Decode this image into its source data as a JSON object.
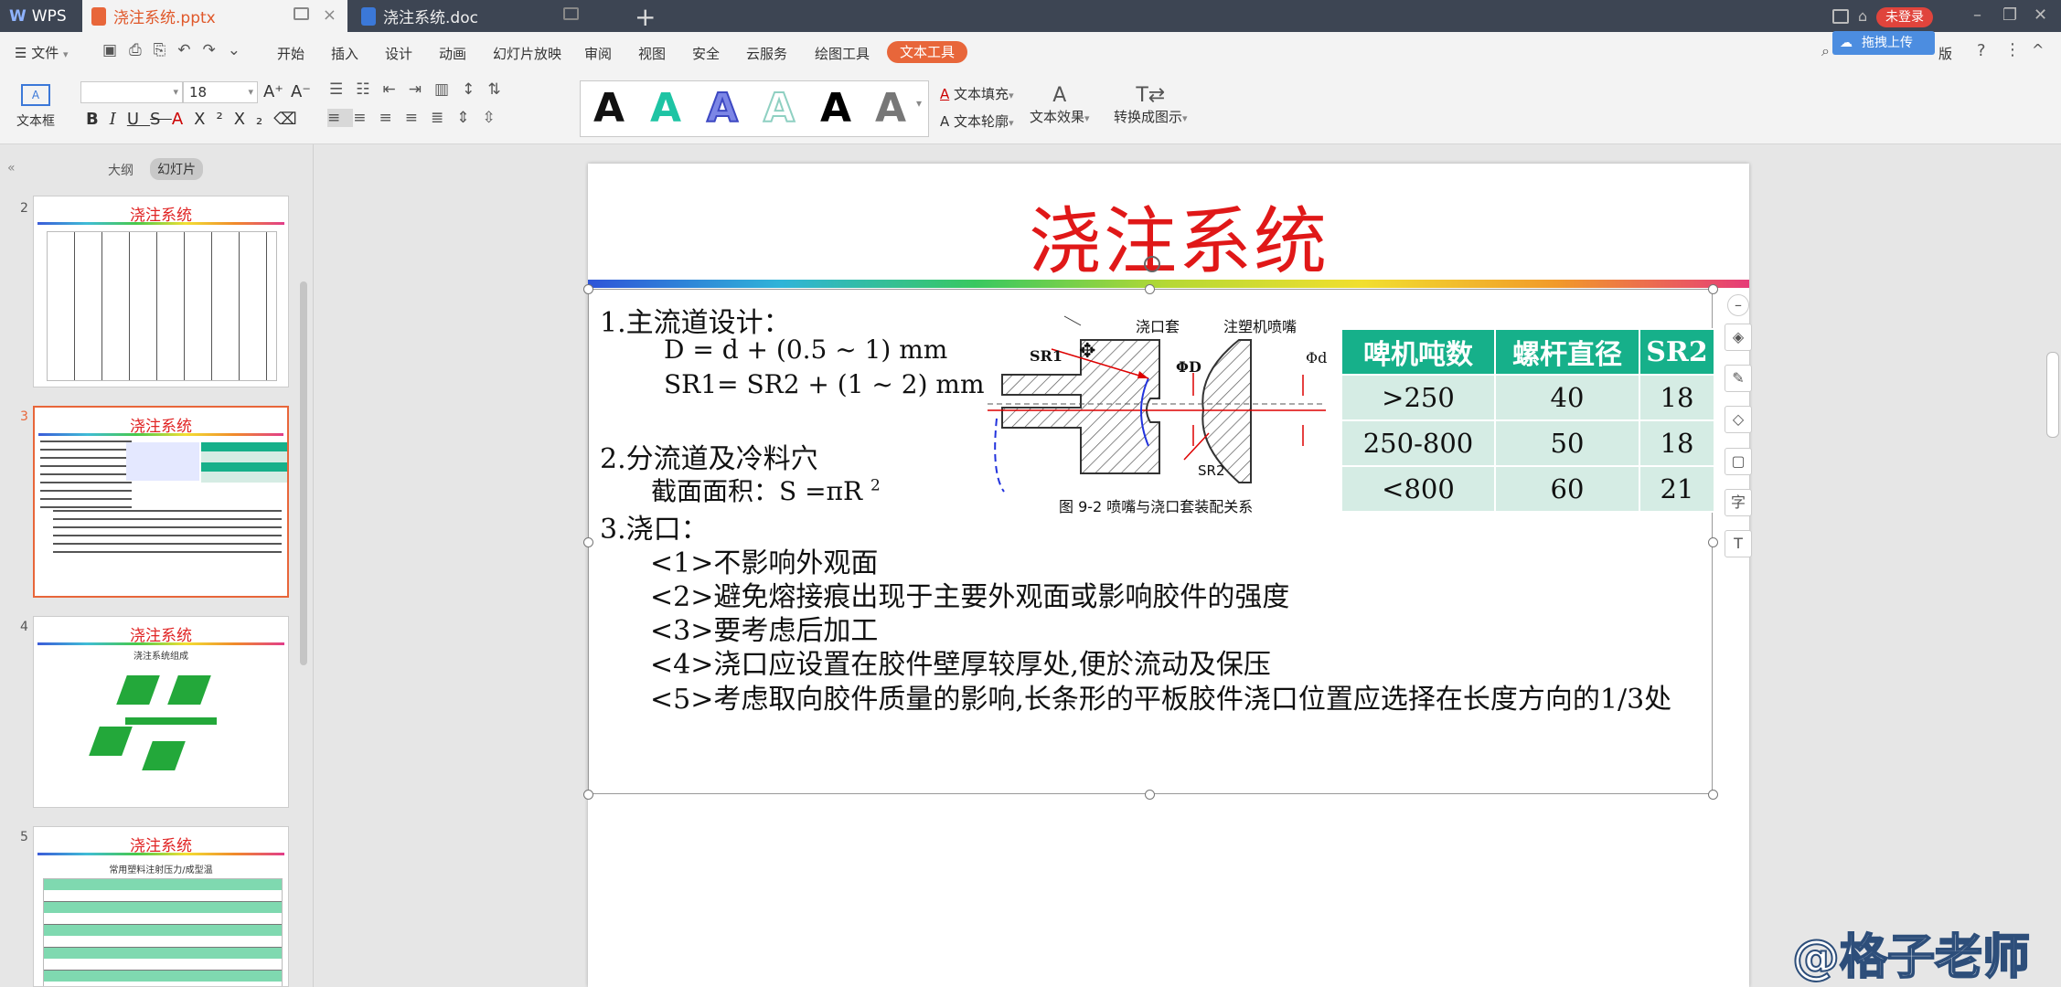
{
  "tabs": [
    {
      "label": "WPS"
    },
    {
      "label": "浇注系统.pptx"
    },
    {
      "label": "浇注系统.doc"
    }
  ],
  "login_label": "未登录",
  "upload_label": "拖拽上传",
  "menu": {
    "file": "文件",
    "items": [
      "开始",
      "插入",
      "设计",
      "动画",
      "幻灯片放映",
      "审阅",
      "视图",
      "安全",
      "云服务",
      "绘图工具"
    ],
    "active": "文本工具",
    "right_label": "版"
  },
  "ribbon": {
    "textbox_label": "文本框",
    "font_size": "18",
    "fill_label": "文本填充",
    "outline_label": "文本轮廓",
    "effect_label": "文本效果",
    "convert_label": "转换成图示",
    "gallery_letter": "A"
  },
  "left_panel": {
    "outline_tab": "大纲",
    "slides_tab": "幻灯片",
    "thumbs": [
      {
        "num": "2",
        "title": "浇注系统"
      },
      {
        "num": "3",
        "title": "浇注系统"
      },
      {
        "num": "4",
        "title": "浇注系统",
        "subtitle": "浇注系统组成"
      },
      {
        "num": "5",
        "title": "浇注系统",
        "subtitle": "常用塑料注射压力/成型温"
      }
    ]
  },
  "slide": {
    "title": "浇注系统",
    "lines": {
      "h1": "1.主流道设计：",
      "f1": "D = d + (0.5 ~ 1) mm",
      "f2": "SR1= SR2 + (1 ~ 2) mm",
      "h2": "2.分流道及冷料穴",
      "area": "截面面积：S =πR",
      "area_sup": "2",
      "h3": "3.浇口：",
      "p1": "<1>不影响外观面",
      "p2": "<2>避免熔接痕出现于主要外观面或影响胶件的强度",
      "p3": "<3>要考虑后加工",
      "p4": "<4>浇口应设置在胶件壁厚较厚处,便於流动及保压",
      "p5": "<5>考虑取向胶件质量的影响,长条形的平板胶件浇口位置应选择在长度方向的1/3处"
    },
    "figure": {
      "label_sprue": "浇口套",
      "label_nozzle": "注塑机喷嘴",
      "label_sr1": "SR1",
      "label_phiD": "ΦD",
      "label_phid": "Φd",
      "label_sr2": "SR2",
      "caption": "图 9-2 喷嘴与浇口套装配关系"
    },
    "table": {
      "headers": [
        "啤机吨数",
        "螺杆直径",
        "SR2"
      ],
      "rows": [
        [
          ">250",
          "40",
          "18"
        ],
        [
          "250-800",
          "50",
          "18"
        ],
        [
          "<800",
          "60",
          "21"
        ]
      ]
    }
  },
  "watermark": "@格子老师",
  "colors": {
    "title_red": "#e01818",
    "table_header": "#16b08a",
    "table_cell": "#d5ece4",
    "accent_orange": "#e8663a"
  }
}
